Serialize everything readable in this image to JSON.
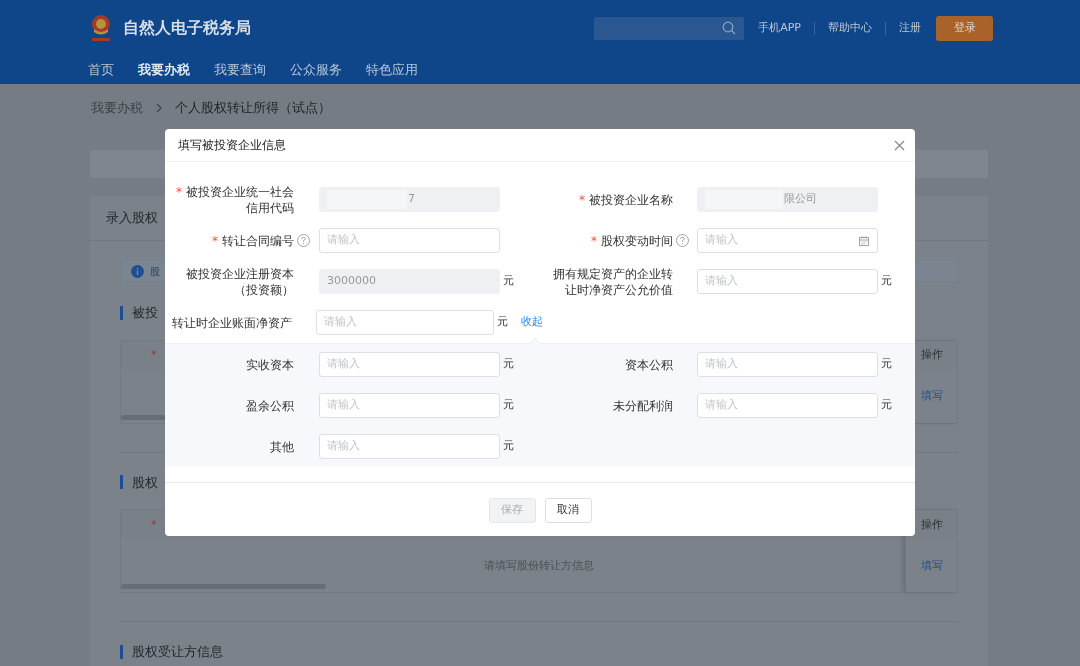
{
  "header": {
    "site_title": "自然人电子税务局",
    "links": [
      "手机APP",
      "帮助中心",
      "注册"
    ],
    "login_button": "登录"
  },
  "nav": [
    {
      "label": "首页",
      "selected": false
    },
    {
      "label": "我要办税",
      "selected": true
    },
    {
      "label": "我要查询",
      "selected": false
    },
    {
      "label": "公众服务",
      "selected": false
    },
    {
      "label": "特色应用",
      "selected": false
    }
  ],
  "breadcrumb": [
    "我要办税",
    "个人股权转让所得（试点）"
  ],
  "background": {
    "card_title": "录入股权",
    "notice": "股",
    "sections": [
      {
        "title": "被投",
        "table": {
          "required_mark": "*",
          "action_header": "操作",
          "action": "填写"
        }
      },
      {
        "title": "股权",
        "table": {
          "required_mark": "*",
          "action_header": "操作",
          "empty_text": "请填写股份转让方信息",
          "action": "填写"
        }
      },
      {
        "title": "股权受让方信息"
      }
    ]
  },
  "dialog": {
    "title": "填写被投资企业信息",
    "rows": [
      [
        {
          "required_mark": "*",
          "label": [
            "被投资企业统一社会",
            "信用代码"
          ],
          "kind": "redacted",
          "value": "7",
          "readonly": true
        },
        {
          "required_mark": "*",
          "label": [
            "被投资企业名称"
          ],
          "kind": "redacted",
          "value": "限公司",
          "readonly": true
        }
      ],
      [
        {
          "required_mark": "*",
          "label": [
            "转让合同编号"
          ],
          "help": true,
          "kind": "text",
          "placeholder": "请输入",
          "readonly": false
        },
        {
          "required_mark": "*",
          "label": [
            "股权变动时间"
          ],
          "help": true,
          "kind": "date",
          "placeholder": "请输入",
          "readonly": false
        }
      ],
      [
        {
          "label": [
            "被投资企业注册资本",
            "（投资额）"
          ],
          "kind": "text",
          "value": "3000000",
          "readonly": true,
          "unit": "元"
        },
        {
          "label": [
            "拥有规定资产的企业转",
            "让时净资产公允价值"
          ],
          "kind": "text",
          "placeholder": "请输入",
          "readonly": false,
          "unit": "元"
        }
      ],
      [
        {
          "label": [
            "转让时企业账面净资产"
          ],
          "kind": "text",
          "placeholder": "请输入",
          "readonly": false,
          "unit": "元",
          "link": "收起"
        }
      ]
    ],
    "detail_rows": [
      [
        {
          "label": [
            "实收资本"
          ],
          "kind": "text",
          "placeholder": "请输入",
          "readonly": false,
          "unit": "元"
        },
        {
          "label": [
            "资本公积"
          ],
          "kind": "text",
          "placeholder": "请输入",
          "readonly": false,
          "unit": "元"
        }
      ],
      [
        {
          "label": [
            "盈余公积"
          ],
          "kind": "text",
          "placeholder": "请输入",
          "readonly": false,
          "unit": "元"
        },
        {
          "label": [
            "未分配利润"
          ],
          "kind": "text",
          "placeholder": "请输入",
          "readonly": false,
          "unit": "元"
        }
      ],
      [
        {
          "label": [
            "其他"
          ],
          "kind": "text",
          "placeholder": "请输入",
          "readonly": false,
          "unit": "元"
        }
      ]
    ],
    "buttons": [
      {
        "label": "保存",
        "disabled": true
      },
      {
        "label": "取消",
        "disabled": false
      }
    ]
  }
}
